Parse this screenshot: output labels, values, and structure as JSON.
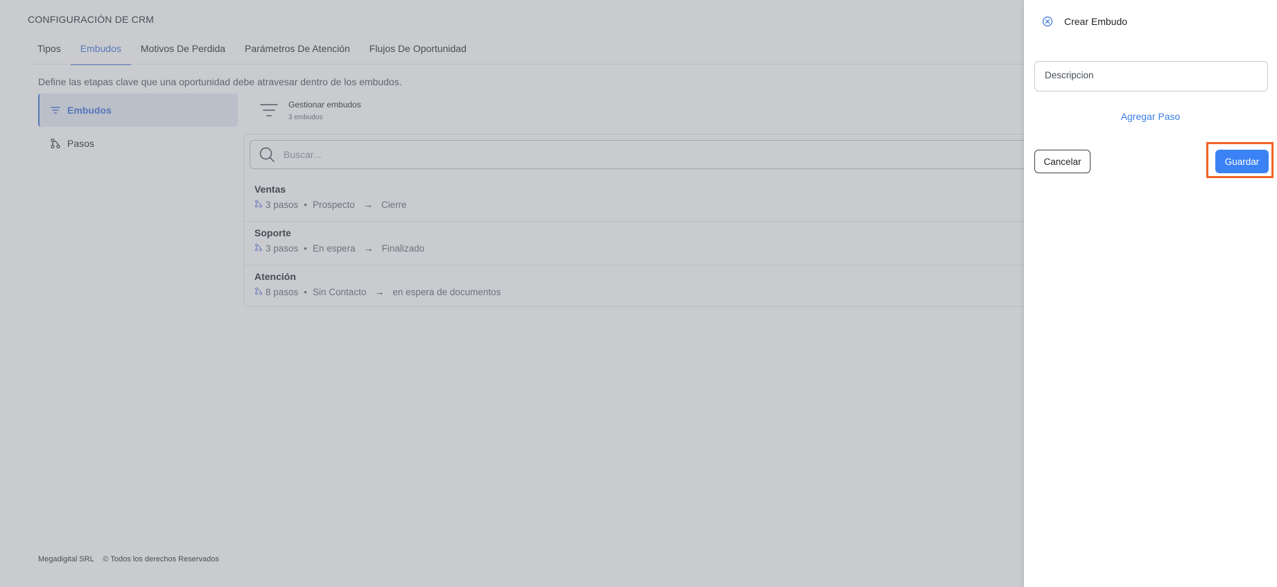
{
  "page": {
    "title": "CONFIGURACIÓN DE CRM",
    "description": "Define las etapas clave que una oportunidad debe atravesar dentro de los embudos."
  },
  "tabs": [
    {
      "label": "Tipos",
      "active": false
    },
    {
      "label": "Embudos",
      "active": true
    },
    {
      "label": "Motivos De Perdida",
      "active": false
    },
    {
      "label": "Parámetros De Atención",
      "active": false
    },
    {
      "label": "Flujos De Oportunidad",
      "active": false
    }
  ],
  "sidebar": {
    "items": [
      {
        "label": "Embudos",
        "icon": "filter-lines-icon",
        "active": true
      },
      {
        "label": "Pasos",
        "icon": "steps-icon",
        "active": false
      }
    ]
  },
  "manage": {
    "title": "Gestionar embudos",
    "count": "3 embudos",
    "icon": "filter-lines-icon"
  },
  "search": {
    "placeholder": "Buscar...",
    "value": ""
  },
  "funnels": [
    {
      "name": "Ventas",
      "steps": "3 pasos",
      "separator": "•",
      "from": "Prospecto",
      "arrow": "→",
      "to": "Cierre"
    },
    {
      "name": "Soporte",
      "steps": "3 pasos",
      "separator": "•",
      "from": "En espera",
      "arrow": "→",
      "to": "Finalizado"
    },
    {
      "name": "Atención",
      "steps": "8 pasos",
      "separator": "•",
      "from": "Sin Contacto",
      "arrow": "→",
      "to": "en espera de documentos"
    }
  ],
  "footer": {
    "company": "Megadigital SRL",
    "rights": "© Todos los derechos Reservados"
  },
  "drawer": {
    "title": "Crear Embudo",
    "description_placeholder": "Descripcion",
    "description_value": "",
    "add_step_label": "Agregar Paso",
    "cancel_label": "Cancelar",
    "save_label": "Guardar"
  },
  "colors": {
    "accent": "#3a6fd8",
    "primary_button": "#3b82f6",
    "highlight": "#f06422",
    "link": "#3a7ee8",
    "overlay": "rgba(128,132,140,0.42)"
  }
}
